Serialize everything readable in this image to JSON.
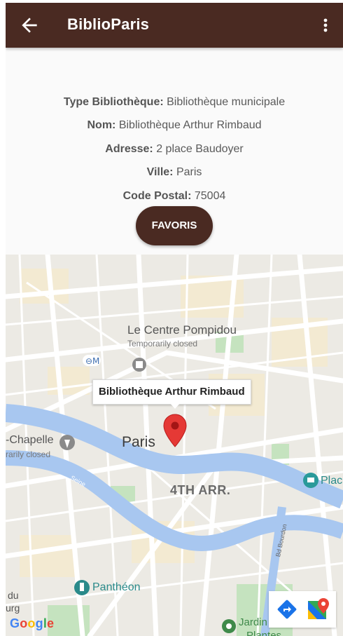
{
  "appbar": {
    "title": "BiblioParis",
    "back_icon": "arrow-left-icon",
    "menu_icon": "more-vert-icon"
  },
  "details": {
    "type_label": "Type Bibliothèque:",
    "type_value": "Bibliothèque municipale",
    "nom_label": "Nom:",
    "nom_value": "Bibliothèque Arthur Rimbaud",
    "adresse_label": "Adresse:",
    "adresse_value": "2 place Baudoyer",
    "ville_label": "Ville:",
    "ville_value": "Paris",
    "cp_label": "Code Postal:",
    "cp_value": "75004"
  },
  "favoris_button": "FAVORIS",
  "map": {
    "marker_title": "Bibliothèque Arthur Rimbaud",
    "labels": {
      "pompidou": "Le Centre Pompidou",
      "pompidou_status": "Temporarily closed",
      "paris": "Paris",
      "chapelle": "-Chapelle",
      "chapelle_status": "rarily closed",
      "arrondissement": "4TH ARR.",
      "pantheon": "Panthéon",
      "du": "du",
      "urg": "urg",
      "jardin": "Jardin des",
      "plantes": "Plantes",
      "plac": "Plac",
      "bd_bourdon": "Bd Bourdon",
      "seine": "Seine"
    },
    "google_logo": "Google",
    "tools": {
      "directions_icon": "directions-icon",
      "maps_icon": "google-maps-icon"
    },
    "colors": {
      "water": "#a8c7f0",
      "park": "#c5e3bf",
      "road": "#ffffff",
      "land": "#eceae4",
      "marker": "#e53935"
    }
  },
  "colors": {
    "appbar": "#4a2a22",
    "button": "#4a2a22"
  }
}
